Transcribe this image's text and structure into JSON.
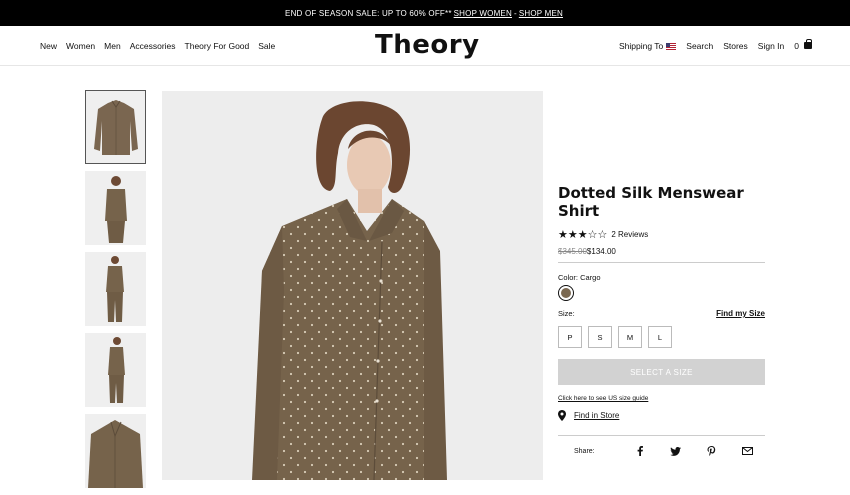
{
  "promo": {
    "text": "END OF SEASON SALE: UP TO 60% OFF**",
    "link_women": "SHOP WOMEN",
    "separator": "-",
    "link_men": "SHOP MEN"
  },
  "nav": {
    "left": [
      "New",
      "Women",
      "Men",
      "Accessories",
      "Theory For Good",
      "Sale"
    ],
    "logo": "Theory",
    "shipping": "Shipping To",
    "search": "Search",
    "stores": "Stores",
    "signin": "Sign In",
    "bag_count": "0"
  },
  "product": {
    "title_line1": "Dotted Silk Menswear",
    "title_line2": "Shirt",
    "stars": "★★★☆☆",
    "rating": 3,
    "reviews": "2 Reviews",
    "old_price": "$345.00",
    "price": "$134.00",
    "color_label": "Color: Cargo",
    "swatch_color": "#7a6851",
    "size_label": "Size:",
    "find_size": "Find my Size",
    "sizes": [
      "P",
      "S",
      "M",
      "L"
    ],
    "select_button": "SELECT A SIZE",
    "size_guide": "Click here to see US size guide",
    "find_store": "Find in Store",
    "share_label": "Share:"
  },
  "colors": {
    "shirt": "#76634b",
    "dots": "#d9cdb8",
    "background": "#ededed"
  }
}
